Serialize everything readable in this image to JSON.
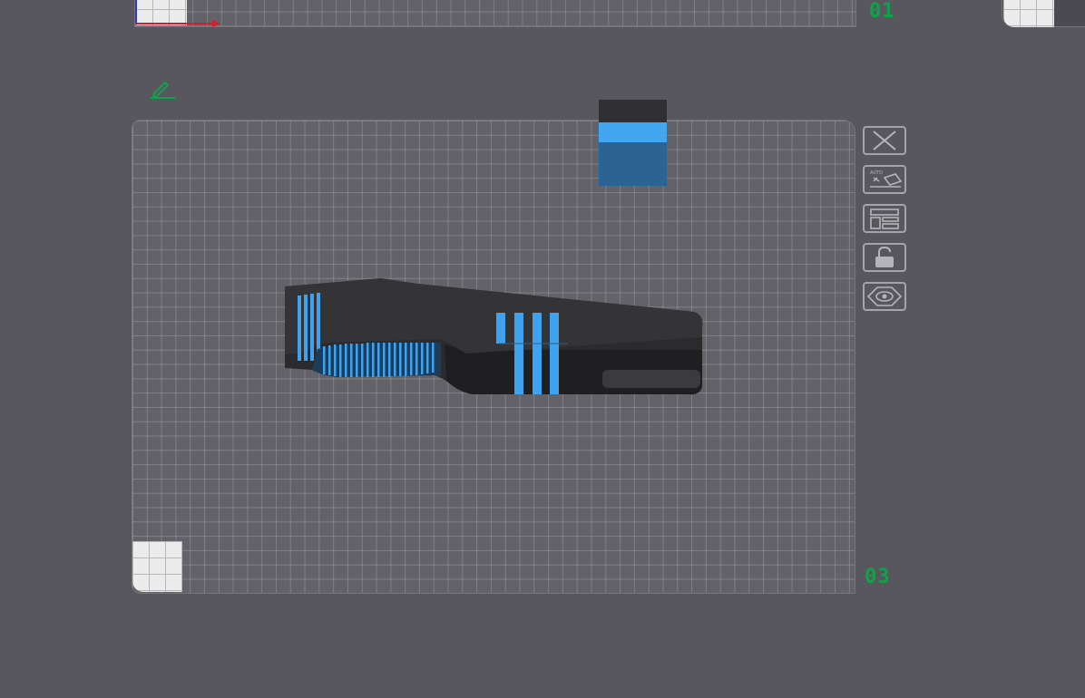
{
  "plates": {
    "top_label": "01",
    "main_label": "03"
  },
  "icons": {
    "edit": "pencil-icon",
    "close": "close-icon",
    "auto_orient": "auto-orient-icon",
    "layout": "layout-icon",
    "lock": "lock-icon",
    "visibility": "eye-icon"
  },
  "toolbar": {
    "auto_label": "AUTO"
  },
  "colors": {
    "background": "#57575d",
    "plate": "#626268",
    "model_body": "#2b2b2e",
    "model_accent": "#3fa2ee",
    "plate_label": "#0ea34a",
    "axis_x": "#d0202a",
    "axis_y": "#2a36d8"
  }
}
